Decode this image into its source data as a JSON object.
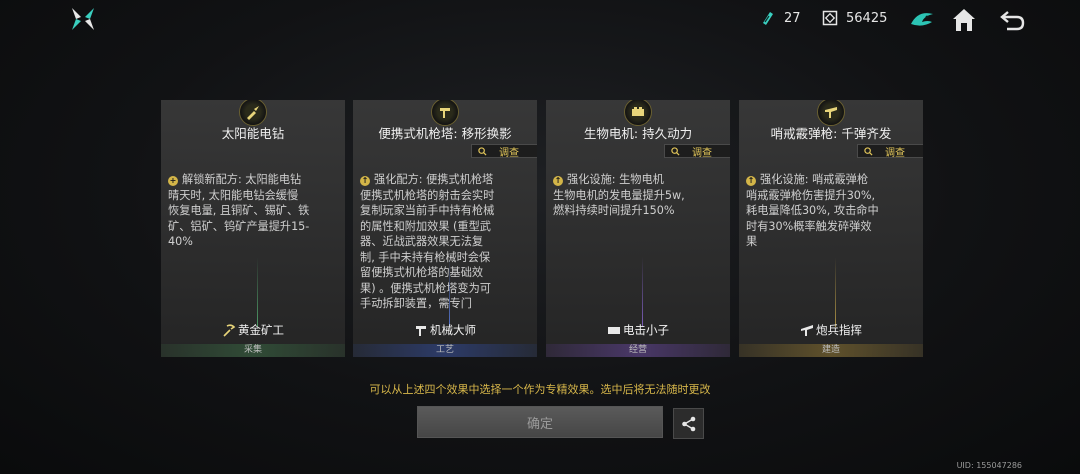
{
  "header": {
    "resources": [
      {
        "icon": "gear-token-icon",
        "value": "27"
      },
      {
        "icon": "coin-icon",
        "value": "56425"
      }
    ],
    "buttons": [
      "bird-emblem-icon",
      "home-icon",
      "back-arrow-icon"
    ]
  },
  "cards": [
    {
      "title": "太阳能电钻",
      "inspect_label": "",
      "body_lines": "解锁新配方: 太阳能电钻\n晴天时, 太阳能电钻会缓慢\n恢复电量, 且铜矿、锡矿、铁\n矿、铝矿、钨矿产量提升15-\n40%",
      "role": "黄金矿工",
      "category": "采集",
      "color": "#3c6b48"
    },
    {
      "title": "便携式机枪塔: 移形换影",
      "inspect_label": "调查",
      "body_lines": "强化配方: 便携式机枪塔\n便携式机枪塔的射击会实时\n复制玩家当前手中持有枪械\n的属性和附加效果 (重型武\n器、近战武器效果无法复\n制, 手中未持有枪械时会保\n留便携式机枪塔的基础效\n果) 。便携式机枪塔变为可\n手动拆卸装置，需专门",
      "role": "机械大师",
      "category": "工艺",
      "color": "#3f5aa8"
    },
    {
      "title": "生物电机: 持久动力",
      "inspect_label": "调查",
      "body_lines": "强化设施: 生物电机\n生物电机的发电量提升5w,\n燃料持续时间提升150%",
      "role": "电击小子",
      "category": "经营",
      "color": "#6a4ea0"
    },
    {
      "title": "哨戒霰弹枪: 千弹齐发",
      "inspect_label": "调查",
      "body_lines": "强化设施: 哨戒霰弹枪\n哨戒霰弹枪伤害提升30%,\n耗电量降低30%, 攻击命中\n时有30%概率触发碎弹效\n果",
      "role": "炮兵指挥",
      "category": "建造",
      "color": "#8c7838"
    }
  ],
  "footer": {
    "hint": "可以从上述四个效果中选择一个作为专精效果。选中后将无法随时更改",
    "confirm_label": "确定",
    "uid": "UID: 155047286"
  },
  "colors": {
    "accent_gold": "#d6b64a",
    "teal": "#3ad0c0"
  }
}
